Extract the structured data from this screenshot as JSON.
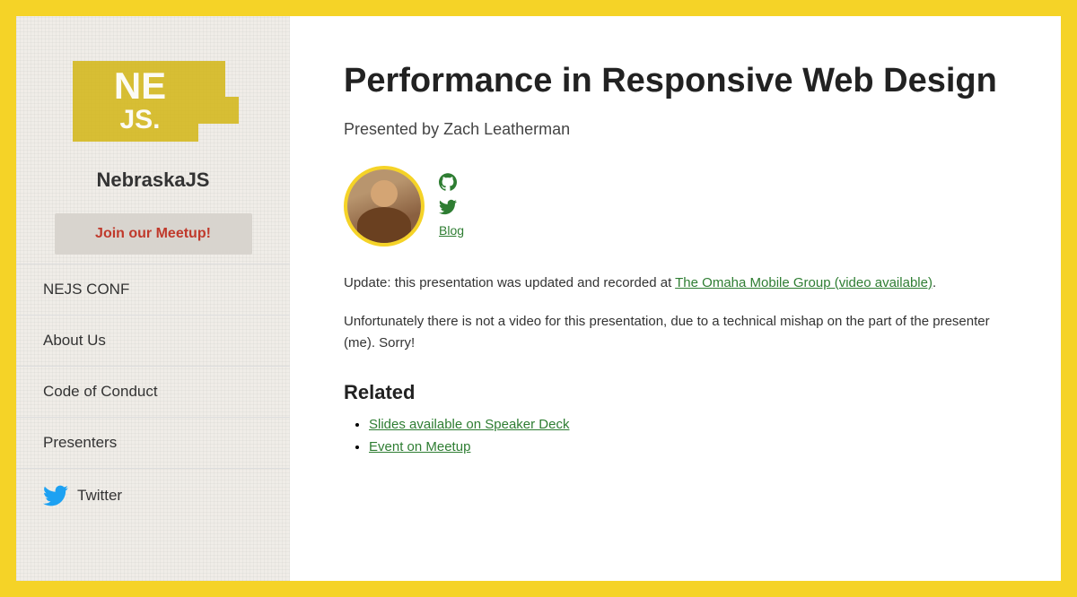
{
  "sidebar": {
    "site_title": "NebraskaJS",
    "meetup_button": "Join our Meetup!",
    "nav_items": [
      {
        "label": "NEJS CONF",
        "id": "nejs-conf"
      },
      {
        "label": "About Us",
        "id": "about-us"
      },
      {
        "label": "Code of Conduct",
        "id": "code-of-conduct"
      },
      {
        "label": "Presenters",
        "id": "presenters"
      }
    ],
    "twitter_label": "Twitter"
  },
  "main": {
    "page_title": "Performance in Responsive Web Design",
    "presenter_line": "Presented by Zach Leatherman",
    "speaker": {
      "name": "Zach Leatherman"
    },
    "update_text_prefix": "Update: this presentation was updated and recorded at ",
    "update_link_text": "The Omaha Mobile Group (video available)",
    "update_text_suffix": ".",
    "no_video_text": "Unfortunately there is not a video for this presentation, due to a technical mishap on the part of the presenter (me). Sorry!",
    "related_heading": "Related",
    "related_links": [
      {
        "label": "Slides available on Speaker Deck",
        "url": "#"
      },
      {
        "label": "Event on Meetup",
        "url": "#"
      }
    ]
  }
}
